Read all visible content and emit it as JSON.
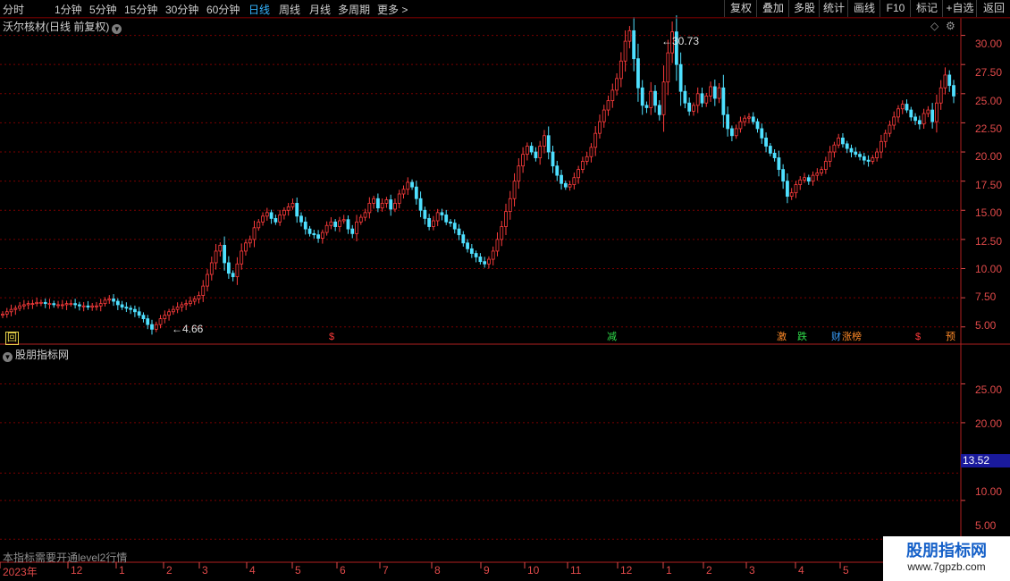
{
  "toolbar": {
    "periods": [
      {
        "label": "分时",
        "active": false
      },
      {
        "label": "1分钟",
        "active": false
      },
      {
        "label": "5分钟",
        "active": false
      },
      {
        "label": "15分钟",
        "active": false
      },
      {
        "label": "30分钟",
        "active": false
      },
      {
        "label": "60分钟",
        "active": false
      },
      {
        "label": "日线",
        "active": true
      },
      {
        "label": "周线",
        "active": false
      },
      {
        "label": "月线",
        "active": false
      },
      {
        "label": "多周期",
        "active": false
      },
      {
        "label": "更多 >",
        "active": false
      }
    ],
    "right_buttons": [
      "复权",
      "叠加",
      "多股",
      "统计",
      "画线",
      "F10",
      "标记",
      "+自选",
      "返回"
    ]
  },
  "price_panel": {
    "title": "沃尔核材(日线 前复权)",
    "y_ticks": [
      "30.00",
      "27.50",
      "25.00",
      "22.50",
      "20.00",
      "17.50",
      "15.00",
      "12.50",
      "10.00",
      "7.50",
      "5.00"
    ],
    "high_label": "30.73",
    "low_label": "4.66"
  },
  "event_markers": [
    {
      "text": "回",
      "color": "#e8d44a"
    },
    {
      "text": "$",
      "color": "#ff3b3b"
    },
    {
      "text": "减",
      "color": "#2fdc4a"
    },
    {
      "text": "激",
      "color": "#ff8a28"
    },
    {
      "text": "跌",
      "color": "#2fdc4a"
    },
    {
      "text": "财",
      "color": "#3aa0ff"
    },
    {
      "text": "涨榜",
      "color": "#ff8a28"
    },
    {
      "text": "$",
      "color": "#ff3b3b"
    },
    {
      "text": "预",
      "color": "#ff8a28"
    }
  ],
  "indicator_panel": {
    "title": "股朋指标网",
    "y_ticks": [
      "25.00",
      "20.00",
      "10.00",
      "5.00"
    ],
    "current_value": "13.52",
    "notice": "本指标需要开通level2行情"
  },
  "date_axis": [
    "2023年",
    "12",
    "1",
    "2",
    "3",
    "4",
    "5",
    "6",
    "7",
    "8",
    "9",
    "10",
    "11",
    "12",
    "1",
    "2",
    "3",
    "4",
    "5"
  ],
  "watermark": {
    "title": "股朋指标网",
    "url": "www.7gpzb.com"
  },
  "colors": {
    "up": "#ff3c3c",
    "down": "#4fe0ff",
    "grid": "#7a0000",
    "axis": "#e14a4a",
    "active_tab": "#34b4ff"
  },
  "chart_data": {
    "type": "candlestick",
    "title": "沃尔核材(日线 前复权)",
    "ylim": [
      3.6,
      31.5
    ],
    "x_range": [
      "2023-11",
      "2025-05"
    ],
    "closes": [
      6.1,
      6.3,
      6.5,
      6.6,
      6.8,
      6.9,
      7.0,
      7.0,
      7.1,
      7.1,
      7.0,
      7.0,
      6.9,
      6.9,
      6.9,
      7.0,
      7.0,
      6.9,
      6.8,
      6.8,
      6.7,
      6.8,
      6.8,
      7.0,
      7.3,
      7.4,
      7.2,
      6.9,
      6.7,
      6.6,
      6.5,
      6.3,
      6.0,
      5.7,
      5.2,
      4.8,
      5.2,
      5.7,
      6.0,
      6.3,
      6.5,
      6.7,
      6.9,
      7.0,
      7.2,
      7.4,
      7.7,
      8.5,
      9.5,
      10.5,
      11.5,
      12.0,
      10.5,
      9.6,
      9.3,
      10.4,
      11.5,
      12.2,
      12.5,
      13.5,
      14.0,
      14.5,
      14.8,
      14.3,
      14.0,
      14.6,
      15.0,
      15.3,
      15.6,
      14.5,
      14.0,
      13.4,
      13.0,
      12.9,
      12.6,
      13.1,
      13.7,
      14.0,
      13.6,
      14.1,
      14.2,
      13.4,
      13.0,
      14.0,
      14.4,
      14.8,
      15.6,
      16.0,
      15.2,
      15.6,
      15.9,
      15.1,
      15.6,
      16.4,
      16.8,
      17.4,
      17.0,
      16.0,
      15.0,
      14.3,
      13.6,
      14.1,
      14.8,
      14.6,
      14.0,
      13.9,
      13.4,
      12.9,
      12.2,
      11.7,
      11.3,
      11.0,
      10.6,
      10.4,
      10.8,
      11.5,
      12.5,
      13.6,
      14.9,
      16.0,
      17.5,
      18.8,
      19.8,
      20.5,
      20.0,
      19.5,
      20.5,
      21.4,
      20.0,
      18.8,
      18.0,
      17.3,
      17.0,
      17.2,
      17.8,
      18.5,
      19.2,
      19.6,
      20.4,
      21.6,
      22.6,
      23.6,
      24.4,
      25.3,
      26.3,
      27.8,
      29.5,
      30.4,
      28.0,
      25.5,
      24.0,
      23.8,
      25.2,
      24.0,
      23.2,
      26.0,
      28.5,
      30.3,
      27.5,
      25.2,
      24.2,
      23.5,
      24.0,
      25.0,
      24.2,
      24.8,
      25.6,
      24.6,
      25.5,
      23.2,
      22.0,
      21.4,
      22.0,
      22.6,
      22.9,
      23.0,
      22.6,
      22.0,
      21.2,
      20.5,
      19.9,
      19.5,
      18.5,
      17.5,
      16.2,
      16.5,
      17.2,
      17.6,
      17.8,
      17.5,
      18.0,
      18.2,
      18.5,
      19.2,
      20.0,
      20.6,
      21.2,
      20.7,
      20.3,
      20.0,
      19.8,
      19.6,
      19.3,
      19.2,
      19.5,
      20.0,
      20.9,
      21.6,
      22.3,
      23.0,
      23.7,
      24.1,
      23.6,
      23.0,
      22.7,
      22.4,
      23.3,
      23.6,
      22.6,
      24.2,
      25.5,
      26.6,
      25.7,
      24.8
    ],
    "high_marker": 30.73,
    "low_marker": 4.66,
    "indicator_ylim": [
      4.0,
      30.0
    ],
    "indicator_current": 13.52
  }
}
